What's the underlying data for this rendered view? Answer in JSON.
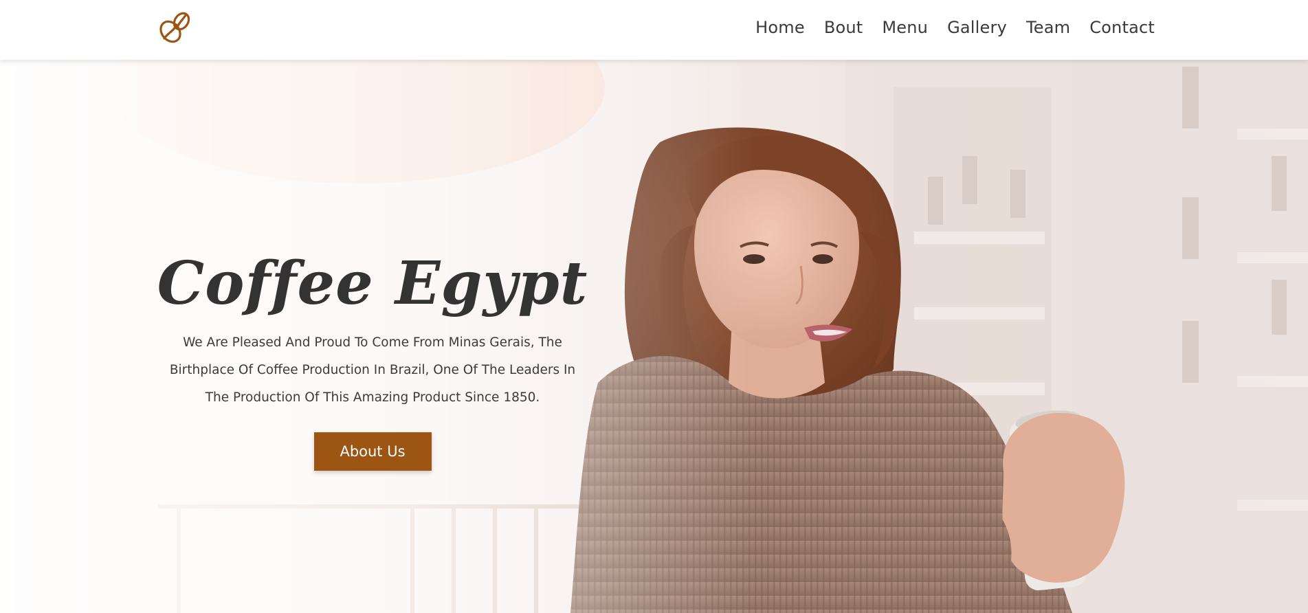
{
  "header": {
    "logo_icon": "coffee-bean-icon",
    "nav": [
      {
        "label": "Home"
      },
      {
        "label": "Bout"
      },
      {
        "label": "Menu"
      },
      {
        "label": "Gallery"
      },
      {
        "label": "Team"
      },
      {
        "label": "Contact"
      }
    ]
  },
  "hero": {
    "title": "Coffee Egypt",
    "description": "We Are Pleased And Proud To Come From Minas Gerais, The Birthplace Of Coffee Production In Brazil, One Of The Leaders In The Production Of This Amazing Product Since 1850.",
    "button_label": "About Us"
  },
  "colors": {
    "accent": "#9d5514",
    "nav_text": "#3a3a3a",
    "title_text": "#333333",
    "header_bg": "#ffffff"
  }
}
